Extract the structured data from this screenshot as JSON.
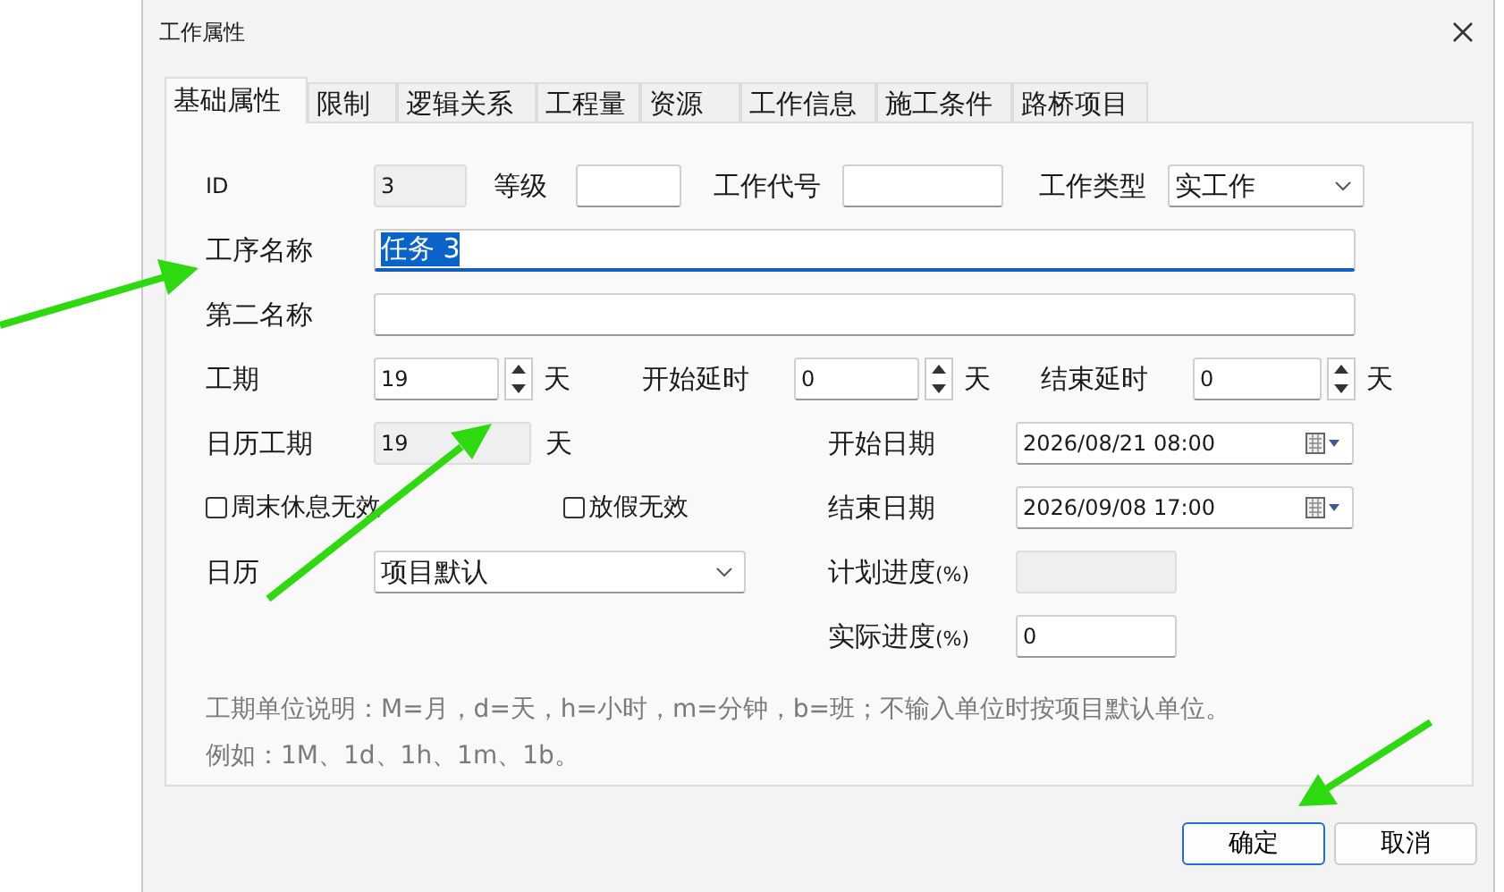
{
  "window": {
    "title": "工作属性"
  },
  "tabs": [
    {
      "label": "基础属性",
      "selected": true
    },
    {
      "label": "限制",
      "selected": false
    },
    {
      "label": "逻辑关系",
      "selected": false
    },
    {
      "label": "工程量",
      "selected": false
    },
    {
      "label": "资源",
      "selected": false
    },
    {
      "label": "工作信息",
      "selected": false
    },
    {
      "label": "施工条件",
      "selected": false
    },
    {
      "label": "路桥项目",
      "selected": false
    }
  ],
  "form": {
    "id": {
      "label": "ID",
      "value": "3",
      "disabled": true
    },
    "level": {
      "label": "等级"
    },
    "code": {
      "label": "工作代号"
    },
    "type": {
      "label": "工作类型",
      "value": "实工作"
    },
    "name": {
      "label": "工序名称",
      "value": "任务 3",
      "text_selected": true,
      "focused": true
    },
    "second_name": {
      "label": "第二名称"
    },
    "duration": {
      "label": "工期",
      "value": "19",
      "unit": "天"
    },
    "start_delay": {
      "label": "开始延时",
      "value": "0",
      "unit": "天"
    },
    "end_delay": {
      "label": "结束延时",
      "value": "0",
      "unit": "天"
    },
    "calendar_duration": {
      "label": "日历工期",
      "value": "19",
      "unit": "天",
      "disabled": true
    },
    "checkboxes": [
      {
        "label": "周末休息无效",
        "checked": false
      },
      {
        "label": "放假无效",
        "checked": false
      }
    ],
    "calendar": {
      "label": "日历",
      "value": "项目默认"
    },
    "start_date": {
      "label": "开始日期",
      "value": "2026/08/21 08:00"
    },
    "end_date": {
      "label": "结束日期",
      "value": "2026/09/08 17:00"
    },
    "planned_progress": {
      "label": "计划进度",
      "unit": "(%)",
      "disabled": true
    },
    "actual_progress": {
      "label": "实际进度",
      "unit": "(%)",
      "value": "0",
      "disabled": false
    }
  },
  "notes": [
    "工期单位说明：M=月，d=天，h=小时，m=分钟，b=班；不输入单位时按项目默认单位。",
    "例如：1M、1d、1h、1m、1b。"
  ],
  "buttons": [
    {
      "label": "确定",
      "default": true
    },
    {
      "label": "取消",
      "default": false
    }
  ]
}
